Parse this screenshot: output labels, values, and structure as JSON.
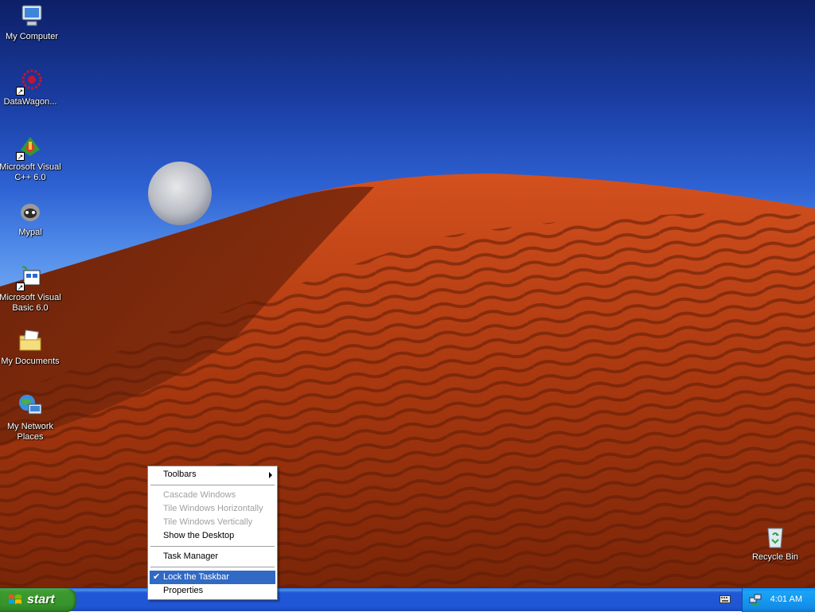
{
  "desktop": {
    "icons": [
      {
        "label": "My Computer",
        "icon": "my-computer-icon"
      },
      {
        "label": "DataWagon...",
        "icon": "datawagon-icon"
      },
      {
        "label": "Microsoft Visual C++ 6.0",
        "icon": "visual-cpp-icon"
      },
      {
        "label": "Mypal",
        "icon": "mypal-icon"
      },
      {
        "label": "Microsoft Visual Basic 6.0",
        "icon": "visual-basic-icon"
      },
      {
        "label": "My Documents",
        "icon": "my-documents-icon"
      },
      {
        "label": "My Network Places",
        "icon": "network-places-icon"
      },
      {
        "label": "Recycle Bin",
        "icon": "recycle-bin-icon"
      }
    ]
  },
  "context_menu": {
    "items": [
      {
        "label": "Toolbars",
        "state": "enabled",
        "submenu": true
      },
      {
        "label": "Cascade Windows",
        "state": "disabled"
      },
      {
        "label": "Tile Windows Horizontally",
        "state": "disabled"
      },
      {
        "label": "Tile Windows Vertically",
        "state": "disabled"
      },
      {
        "label": "Show the Desktop",
        "state": "enabled"
      },
      {
        "label": "Task Manager",
        "state": "enabled"
      },
      {
        "label": "Lock the Taskbar",
        "state": "highlighted",
        "checked": true
      },
      {
        "label": "Properties",
        "state": "enabled"
      }
    ]
  },
  "taskbar": {
    "start_label": "start",
    "clock": "4:01 AM"
  },
  "colors": {
    "start_green": "#37932b",
    "taskbar_blue": "#2055d6",
    "tray_blue": "#138de9",
    "menu_highlight": "#316ac5"
  }
}
